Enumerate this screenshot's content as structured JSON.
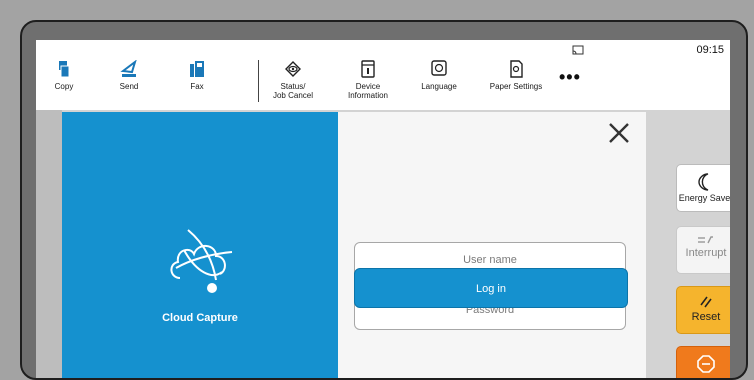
{
  "clock": "09:15",
  "topbar": {
    "items": [
      {
        "label": "Copy",
        "icon": "copy-icon"
      },
      {
        "label": "Send",
        "icon": "send-icon"
      },
      {
        "label": "Fax",
        "icon": "fax-icon"
      },
      {
        "label_line1": "Status/",
        "label_line2": "Job Cancel",
        "icon": "eye-icon"
      },
      {
        "label_line1": "Device",
        "label_line2": "Information",
        "icon": "info-icon"
      },
      {
        "label": "Language",
        "icon": "language-icon"
      },
      {
        "label": "Paper Settings",
        "icon": "paper-icon"
      }
    ],
    "more": "•••",
    "cast_icon": "cast-icon"
  },
  "dialog": {
    "brand": "Cloud Capture",
    "username_placeholder": "User name",
    "password_placeholder": "Password",
    "login_label": "Log in",
    "close_icon": "close-icon"
  },
  "right_panel": {
    "energy_saver": "Energy Saver",
    "interrupt": "Interrupt",
    "reset": "Reset",
    "stop_icon": "stop-icon"
  },
  "colors": {
    "accent": "#1591cf",
    "reset": "#f5b42d",
    "stop": "#f07a1c",
    "icon_blue": "#1a78b8"
  }
}
